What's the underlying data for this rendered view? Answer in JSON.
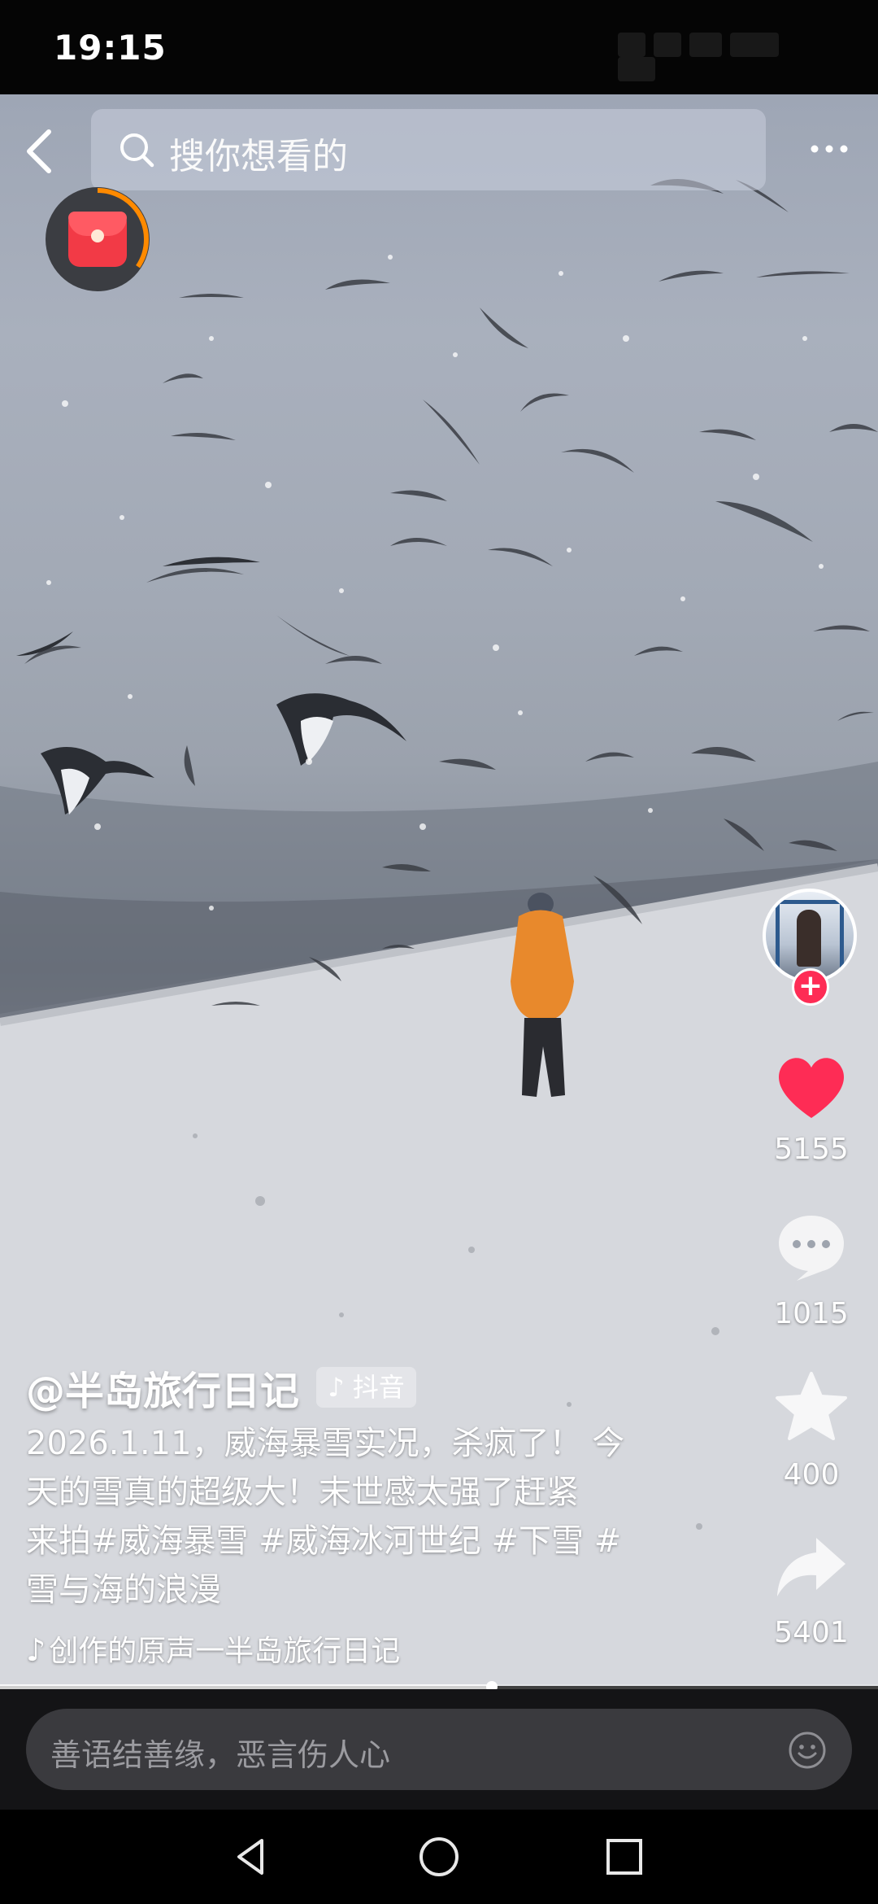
{
  "status_bar": {
    "time": "19:15"
  },
  "search": {
    "placeholder": "搜你想看的"
  },
  "video": {
    "author": "@半岛旅行日记",
    "platform_badge": "抖音",
    "caption_lines": [
      "2026.1.11，威海暴雪实况，杀疯了！ 今",
      "天的雪真的超级大！末世感太强了赶紧",
      "来拍#威海暴雪 #威海冰河世纪 #下雪 #",
      "雪与海的浪漫"
    ],
    "music": "创作的原声一半岛旅行日记",
    "progress": 0.56
  },
  "actions": {
    "follow_symbol": "+",
    "likes": "5155",
    "comments": "1015",
    "favorites": "400",
    "shares": "5401"
  },
  "comment": {
    "placeholder": "善语结善缘，恶言伤人心"
  },
  "colors": {
    "like": "#fe2c55",
    "red_packet": "#f23a46",
    "progress_ring": "#ff8a00"
  },
  "icons": [
    "back-icon",
    "search-icon",
    "more-icon",
    "red-packet-icon",
    "heart-icon",
    "comment-icon",
    "star-icon",
    "share-icon",
    "emoji-icon",
    "nav-back-icon",
    "nav-home-icon",
    "nav-recents-icon"
  ]
}
